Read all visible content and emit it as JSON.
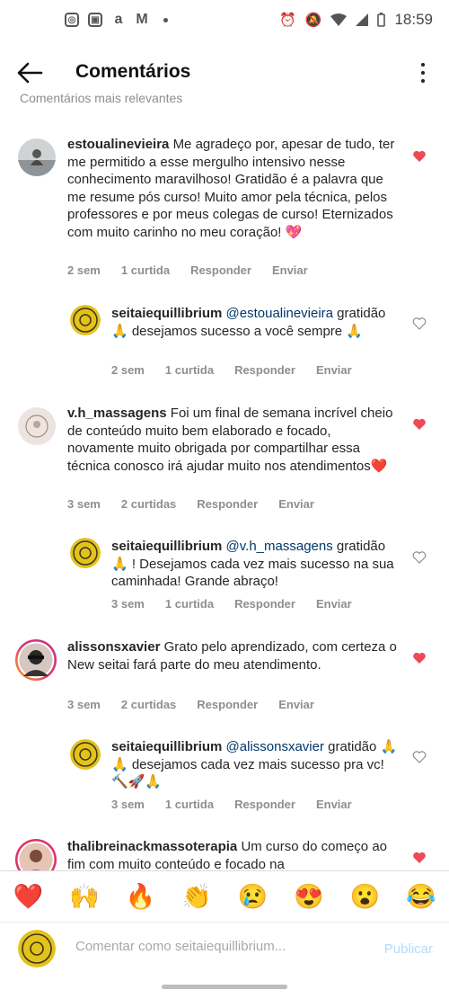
{
  "status_bar": {
    "time": "18:59"
  },
  "header": {
    "title": "Comentários"
  },
  "top_cut_text": "Comentários mais relevantes",
  "comments": [
    {
      "username": "estoualinevieira",
      "text": "Me agradeço por, apesar de tudo, ter me permitido a esse mergulho intensivo nesse conhecimento maravilhoso! Gratidão é a palavra que me resume pós curso! Muito amor pela técnica, pelos professores e por meus colegas de curso! Eternizados com muito carinho no meu coração! 💖",
      "time": "2 sem",
      "likes": "1 curtida",
      "reply": "Responder",
      "send": "Enviar",
      "liked": true,
      "response": {
        "username": "seitaiequillibrium",
        "mention": "@estoualinevieira",
        "text": " gratidão 🙏 desejamos sucesso a você sempre 🙏",
        "time": "2 sem",
        "likes": "1 curtida",
        "reply": "Responder",
        "send": "Enviar",
        "liked": false
      }
    },
    {
      "username": "v.h_massagens",
      "text": "Foi um final de semana incrível cheio de conteúdo muito bem elaborado e focado, novamente muito obrigada por compartilhar essa técnica conosco irá ajudar muito nos atendimentos❤️",
      "time": "3 sem",
      "likes": "2 curtidas",
      "reply": "Responder",
      "send": "Enviar",
      "liked": true,
      "response": {
        "username": "seitaiequillibrium",
        "mention": "@v.h_massagens",
        "text": " gratidão 🙏 ! Desejamos cada vez mais sucesso na sua caminhada! Grande abraço!",
        "time": "3 sem",
        "likes": "1 curtida",
        "reply": "Responder",
        "send": "Enviar",
        "liked": false
      }
    },
    {
      "username": "alissonsxavier",
      "text": "Grato pelo aprendizado, com certeza o New seitai fará parte do meu atendimento.",
      "time": "3 sem",
      "likes": "2 curtidas",
      "reply": "Responder",
      "send": "Enviar",
      "liked": true,
      "response": {
        "username": "seitaiequillibrium",
        "mention": "@alissonsxavier",
        "text": " gratidão 🙏🙏 desejamos cada vez mais sucesso pra vc! 🔨🚀🙏",
        "time": "3 sem",
        "likes": "1 curtida",
        "reply": "Responder",
        "send": "Enviar",
        "liked": false
      }
    },
    {
      "username": "thalibreinackmassoterapia",
      "text": "Um curso do começo ao fim com muito conteúdo e focado na",
      "liked": true
    }
  ],
  "emoji_bar": [
    "❤️",
    "🙌",
    "🔥",
    "👏",
    "😢",
    "😍",
    "😮",
    "😂"
  ],
  "input": {
    "placeholder": "Comentar como seitaiequillibrium...",
    "publish": "Publicar"
  },
  "colors": {
    "like_red": "#ed4956",
    "mention_blue": "#00376b",
    "publish_disabled": "#b3dbff"
  }
}
